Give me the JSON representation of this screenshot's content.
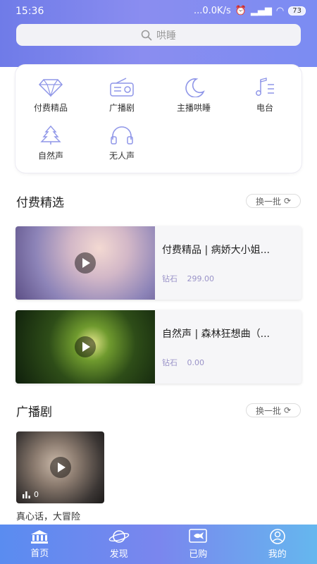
{
  "status_bar": {
    "time": "15:36",
    "network_speed": "...0.0K/s",
    "battery": "73"
  },
  "search": {
    "placeholder": "哄睡"
  },
  "categories": [
    {
      "label": "付费精品",
      "icon": "diamond-icon"
    },
    {
      "label": "广播剧",
      "icon": "radio-icon"
    },
    {
      "label": "主播哄睡",
      "icon": "moon-icon"
    },
    {
      "label": "电台",
      "icon": "music-note-icon"
    },
    {
      "label": "自然声",
      "icon": "tree-icon"
    },
    {
      "label": "无人声",
      "icon": "headphones-icon"
    }
  ],
  "sections": {
    "paid": {
      "title": "付费精选",
      "refresh_label": "换一批",
      "items": [
        {
          "title": "付费精品 | 病娇大小姐...",
          "price_label": "钻石",
          "price": "299.00"
        },
        {
          "title": "自然声 | 森林狂想曲（...",
          "price_label": "钻石",
          "price": "0.00"
        }
      ]
    },
    "drama": {
      "title": "广播剧",
      "refresh_label": "换一批",
      "items": [
        {
          "title": "真心话，大冒险",
          "plays": "0"
        }
      ]
    }
  },
  "tabbar": {
    "tabs": [
      {
        "label": "首页",
        "icon": "home-icon",
        "active": true
      },
      {
        "label": "发现",
        "icon": "planet-icon",
        "active": false
      },
      {
        "label": "已购",
        "icon": "purchased-icon",
        "active": false
      },
      {
        "label": "我的",
        "icon": "profile-icon",
        "active": false
      }
    ]
  },
  "colors": {
    "accent": "#7b86ee",
    "price_text": "#9a93c8"
  }
}
